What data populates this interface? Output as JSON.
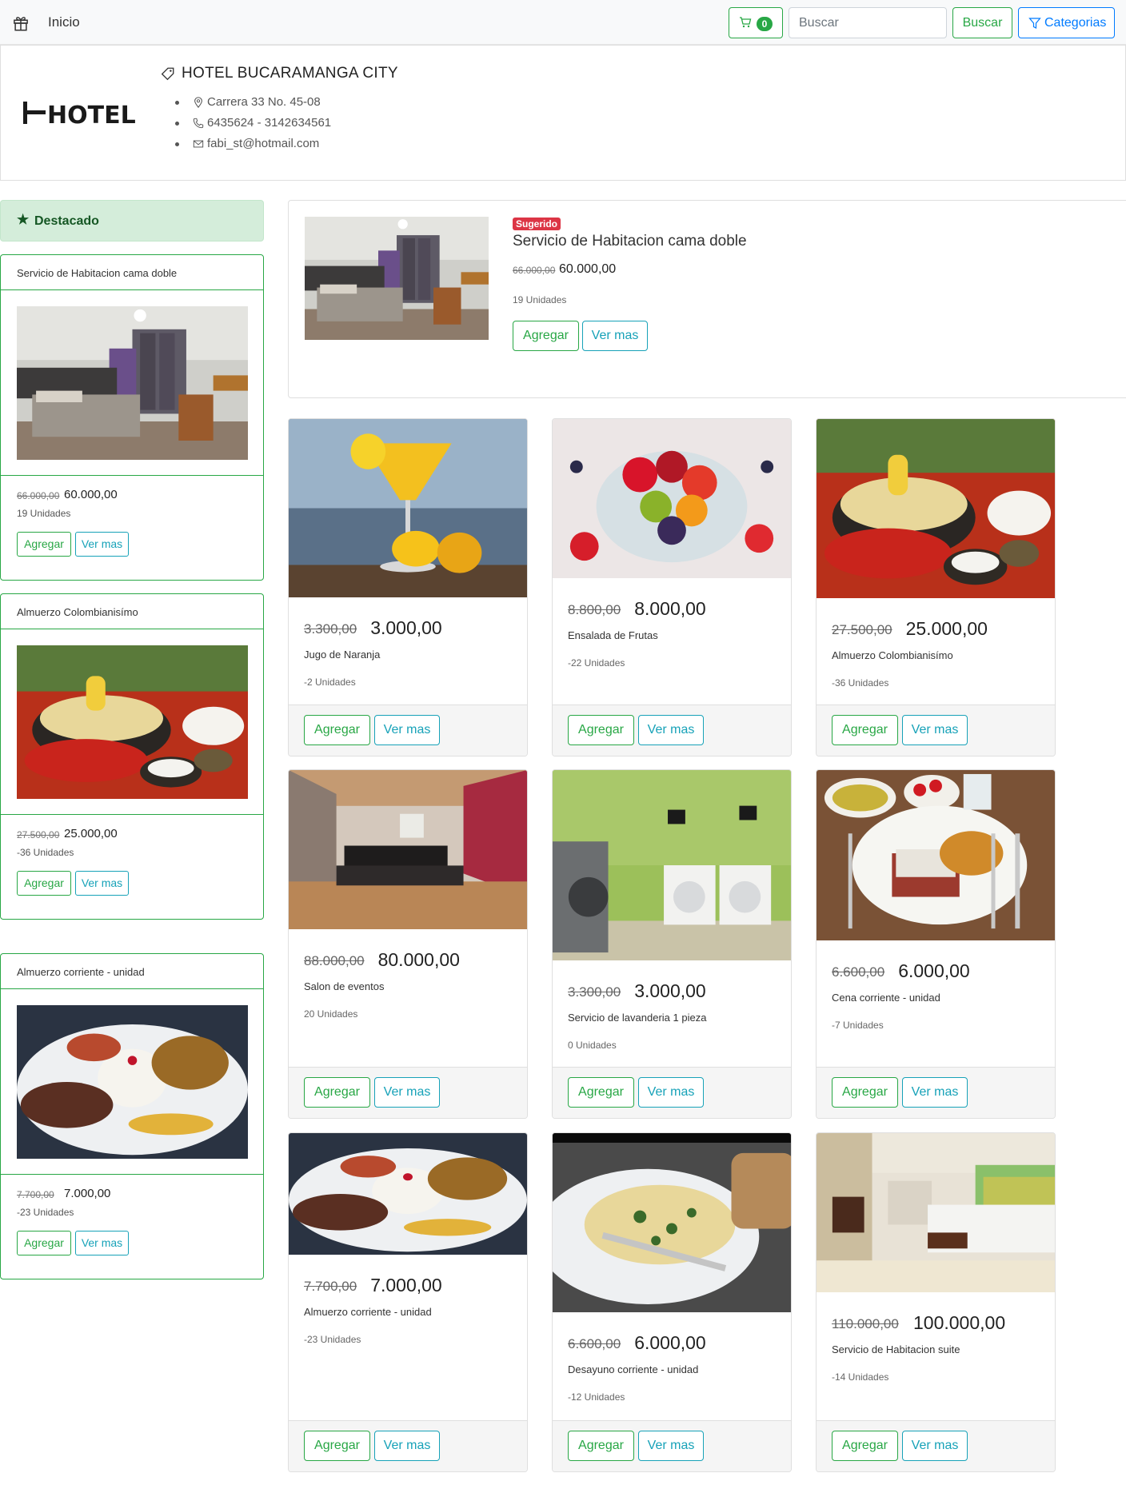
{
  "nav": {
    "home_label": "Inicio",
    "cart_count": "0",
    "search_placeholder": "Buscar",
    "search_button": "Buscar",
    "categories_button": "Categorias"
  },
  "hotel": {
    "logo_text": "HOTEL",
    "name": "HOTEL BUCARAMANGA CITY",
    "address": "Carrera 33 No. 45-08",
    "phone": "6435624 - 3142634561",
    "email": "fabi_st@hotmail.com"
  },
  "sidebar": {
    "heading": "Destacado",
    "items": [
      {
        "title": "Servicio de Habitacion cama doble",
        "old_price": "66.000,00",
        "price": "60.000,00",
        "units": "19 Unidades",
        "add": "Agregar",
        "more": "Ver mas",
        "image": "hotel-room"
      },
      {
        "title": "Almuerzo Colombianisímo",
        "old_price": "27.500,00",
        "price": "25.000,00",
        "units": "-36 Unidades",
        "add": "Agregar",
        "more": "Ver mas",
        "image": "soup-dish"
      },
      {
        "title": "Almuerzo corriente - unidad",
        "old_price": "7.700,00",
        "price": "7.000,00",
        "units": "-23 Unidades",
        "add": "Agregar",
        "more": "Ver mas",
        "image": "rice-plate"
      }
    ]
  },
  "suggested": {
    "badge": "Sugerido",
    "title": "Servicio de Habitacion cama doble",
    "old_price": "66.000,00",
    "price": "60.000,00",
    "units": "19 Unidades",
    "add": "Agregar",
    "more": "Ver mas",
    "image": "hotel-room"
  },
  "products": [
    {
      "old_price": "3.300,00",
      "price": "3.000,00",
      "name": "Jugo de Naranja",
      "units": "-2 Unidades",
      "add": "Agregar",
      "more": "Ver mas",
      "image": "orange-juice"
    },
    {
      "old_price": "8.800,00",
      "price": "8.000,00",
      "name": "Ensalada de Frutas",
      "units": "-22 Unidades",
      "add": "Agregar",
      "more": "Ver mas",
      "image": "fruit-salad"
    },
    {
      "old_price": "27.500,00",
      "price": "25.000,00",
      "name": "Almuerzo Colombianisímo",
      "units": "-36 Unidades",
      "add": "Agregar",
      "more": "Ver mas",
      "image": "soup-dish"
    },
    {
      "old_price": "88.000,00",
      "price": "80.000,00",
      "name": "Salon de eventos",
      "units": "20 Unidades",
      "add": "Agregar",
      "more": "Ver mas",
      "image": "event-room"
    },
    {
      "old_price": "3.300,00",
      "price": "3.000,00",
      "name": "Servicio de lavanderia 1 pieza",
      "units": "0 Unidades",
      "add": "Agregar",
      "more": "Ver mas",
      "image": "laundry"
    },
    {
      "old_price": "6.600,00",
      "price": "6.000,00",
      "name": "Cena corriente - unidad",
      "units": "-7 Unidades",
      "add": "Agregar",
      "more": "Ver mas",
      "image": "dinner-plate"
    },
    {
      "old_price": "7.700,00",
      "price": "7.000,00",
      "name": "Almuerzo corriente - unidad",
      "units": "-23 Unidades",
      "add": "Agregar",
      "more": "Ver mas",
      "image": "rice-plate"
    },
    {
      "old_price": "6.600,00",
      "price": "6.000,00",
      "name": "Desayuno corriente - unidad",
      "units": "-12 Unidades",
      "add": "Agregar",
      "more": "Ver mas",
      "image": "omelette"
    },
    {
      "old_price": "110.000,00",
      "price": "100.000,00",
      "name": "Servicio de Habitacion suite",
      "units": "-14 Unidades",
      "add": "Agregar",
      "more": "Ver mas",
      "image": "suite-room"
    }
  ],
  "colors": {
    "success": "#28a745",
    "info": "#17a2b8",
    "primary": "#007bff",
    "danger": "#dc3545"
  }
}
